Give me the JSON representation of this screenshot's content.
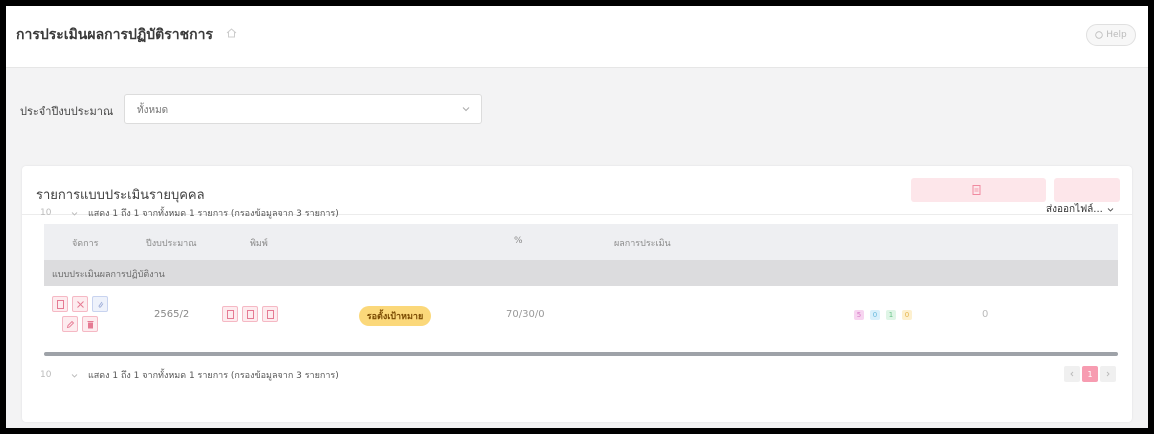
{
  "header": {
    "title": "การประเมินผลการปฏิบัติราชการ",
    "breadcrumb": [
      "",
      "",
      ""
    ],
    "help_label": "Help"
  },
  "filter": {
    "label": "ประจำปีงบประมาณ",
    "value": "ทั้งหมด"
  },
  "card": {
    "title": "รายการแบบประเมินรายบุคคล",
    "report_button": "",
    "add_button": "",
    "export_label": "ส่งออกไฟล์..."
  },
  "pager_top": {
    "per_page": "10",
    "summary": "แสดง 1 ถึง 1 จากทั้งหมด 1 รายการ (กรองข้อมูลจาก 3 รายการ)"
  },
  "table": {
    "columns": [
      "จัดการ",
      "ปีงบประมาณ",
      "พิมพ์",
      "",
      "%",
      "ผลการประเมิน",
      "",
      "",
      "",
      ""
    ],
    "group": "แบบประเมินผลการปฏิบัติงาน",
    "row": {
      "year": "2565/2",
      "status": "รอตั้งเป้าหมาย",
      "percent": "70/30/0",
      "result": "",
      "scores": [
        "5",
        "0",
        "1",
        "0"
      ],
      "indicators": "0"
    }
  },
  "pager_bottom": {
    "per_page": "10",
    "summary": "แสดง 1 ถึง 1 จากทั้งหมด 1 รายการ (กรองข้อมูลจาก 3 รายการ)",
    "current_page": "1"
  },
  "colors": {
    "accent_pink": "#f79cb1",
    "status_yellow": "#fbd87a"
  }
}
